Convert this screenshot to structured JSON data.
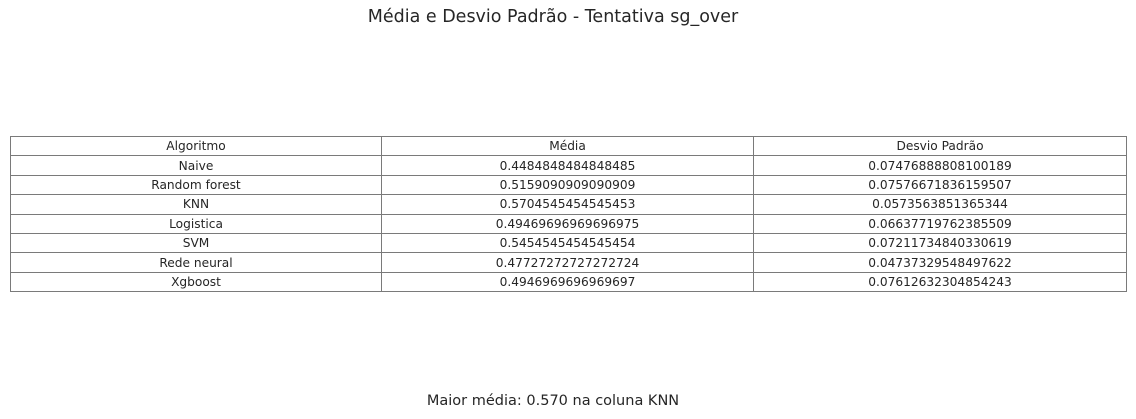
{
  "chart_data": {
    "type": "table",
    "title": "Média e Desvio Padrão - Tentativa sg_over",
    "columns": [
      "Algoritmo",
      "Média",
      "Desvio Padrão"
    ],
    "rows": [
      [
        "Naive",
        "0.4484848484848485",
        "0.07476888808100189"
      ],
      [
        "Random forest",
        "0.5159090909090909",
        "0.07576671836159507"
      ],
      [
        "KNN",
        "0.5704545454545453",
        "0.0573563851365344"
      ],
      [
        "Logistica",
        "0.49469696969696975",
        "0.06637719762385509"
      ],
      [
        "SVM",
        "0.5454545454545454",
        "0.07211734840330619"
      ],
      [
        "Rede neural",
        "0.47727272727272724",
        "0.04737329548497622"
      ],
      [
        "Xgboost",
        "0.4946969696969697",
        "0.07612632304854243"
      ]
    ],
    "footer": "Maior média: 0.570 na coluna KNN",
    "colors": {
      "text": "#262626",
      "grid": "#7a7a7a",
      "background": "#ffffff"
    }
  }
}
